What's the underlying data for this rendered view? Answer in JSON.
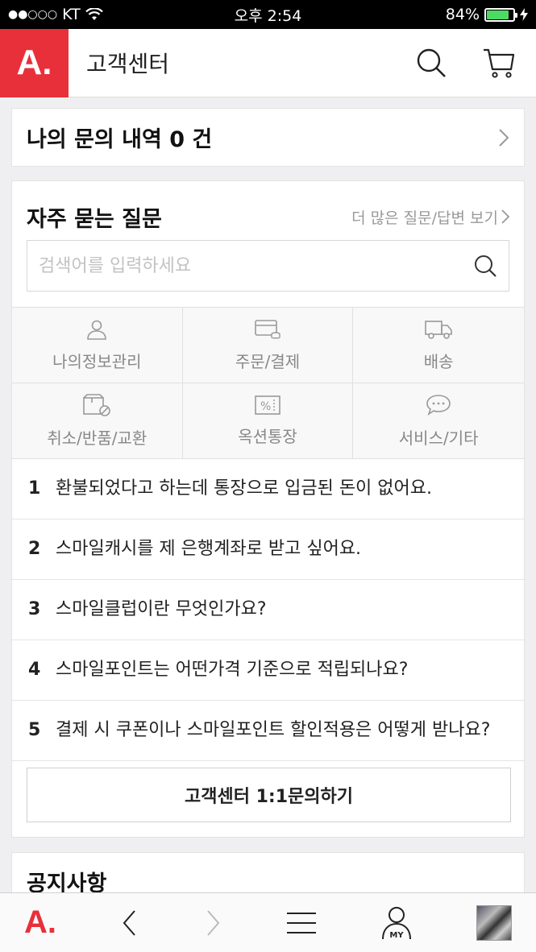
{
  "status_bar": {
    "carrier": "KT",
    "time": "오후 2:54",
    "battery": "84%",
    "battery_level": 0.84
  },
  "header": {
    "logo": "A.",
    "title": "고객센터",
    "icons": [
      "search-icon",
      "cart-icon"
    ]
  },
  "inquiry": {
    "text": "나의 문의 내역 0 건"
  },
  "faq": {
    "title": "자주 묻는 질문",
    "more_link": "더 많은 질문/답변 보기",
    "search_placeholder": "검색어를 입력하세요",
    "categories": [
      {
        "label": "나의정보관리",
        "icon": "person-icon"
      },
      {
        "label": "주문/결제",
        "icon": "card-icon"
      },
      {
        "label": "배송",
        "icon": "truck-icon"
      },
      {
        "label": "취소/반품/교환",
        "icon": "box-cancel-icon"
      },
      {
        "label": "옥션통장",
        "icon": "percent-icon"
      },
      {
        "label": "서비스/기타",
        "icon": "chat-icon"
      }
    ],
    "questions": [
      {
        "num": "1",
        "text": "환불되었다고 하는데 통장으로 입금된 돈이 없어요."
      },
      {
        "num": "2",
        "text": "스마일캐시를 제 은행계좌로 받고 싶어요."
      },
      {
        "num": "3",
        "text": "스마일클럽이란 무엇인가요?"
      },
      {
        "num": "4",
        "text": "스마일포인트는 어떤가격 기준으로 적립되나요?"
      },
      {
        "num": "5",
        "text": "결제 시 쿠폰이나 스마일포인트 할인적용은 어떻게 받나요?"
      }
    ],
    "cs_button": "고객센터 1:1문의하기"
  },
  "notice": {
    "title": "공지사항"
  },
  "bottom_bar": {
    "logo": "A.",
    "my_label": "MY",
    "icons": [
      "back-icon",
      "forward-icon",
      "menu-icon",
      "my-icon",
      "thumbnail"
    ]
  },
  "colors": {
    "brand_red": "#e8303a",
    "battery_green": "#4cd964"
  }
}
